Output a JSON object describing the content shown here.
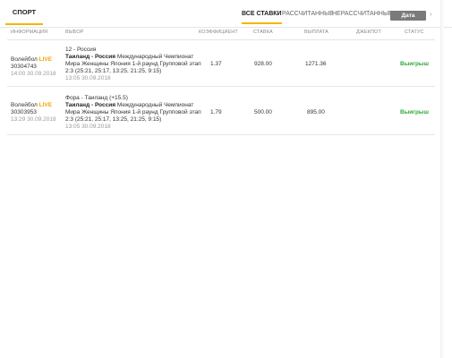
{
  "top": {
    "sport_tab": "СПОРТ",
    "filters": [
      "ВСЕ СТАВКИ",
      "РАССЧИТАННЫЕ",
      "НЕРАССЧИТАННЫЕ"
    ],
    "date_button": "Дата"
  },
  "columns": {
    "info": "ИНФОРМАЦИЯ",
    "selection": "ВЫБОР",
    "coef": "КОЭФФИЦИЕНТ",
    "stake": "СТАВКА",
    "payout": "ВЫПЛАТА",
    "jackpot": "ДЖЕКПОТ",
    "status": "СТАТУС"
  },
  "bets": [
    {
      "sport": "Волейбол",
      "live": "LIVE",
      "id": "30304743",
      "placed": "14:00 30.09.2018",
      "pick": "12 - Россия",
      "match": "Таиланд - Россия",
      "event_line1": "Международный Чемпионат",
      "event_line2": "Мира Женщины Япония 1-й раунд Групповой этап",
      "score": "2:3 (25:21, 25:17, 13:25, 21:25, 9:15)",
      "event_time": "13:05 30.09.2018",
      "coef": "1.37",
      "stake": "928.00",
      "payout": "1271.36",
      "status": "Выигрыш"
    },
    {
      "sport": "Волейбол",
      "live": "LIVE",
      "id": "30303953",
      "placed": "13:29 30.09.2018",
      "pick": "Фора - Таиланд (+15.5)",
      "match": "Таиланд - Россия",
      "event_line1": "Международный Чемпионат",
      "event_line2": "Мира Женщины Япония 1-й раунд Групповой этап",
      "score": "2:3 (25:21, 25:17, 13:25, 21:25, 9:15)",
      "event_time": "13:05 30.09.2018",
      "coef": "1.79",
      "stake": "500.00",
      "payout": "895.00",
      "status": "Выигрыш"
    }
  ],
  "colors": {
    "accent": "#f2b600",
    "win": "#2eaa3a",
    "live": "#f2a600"
  }
}
